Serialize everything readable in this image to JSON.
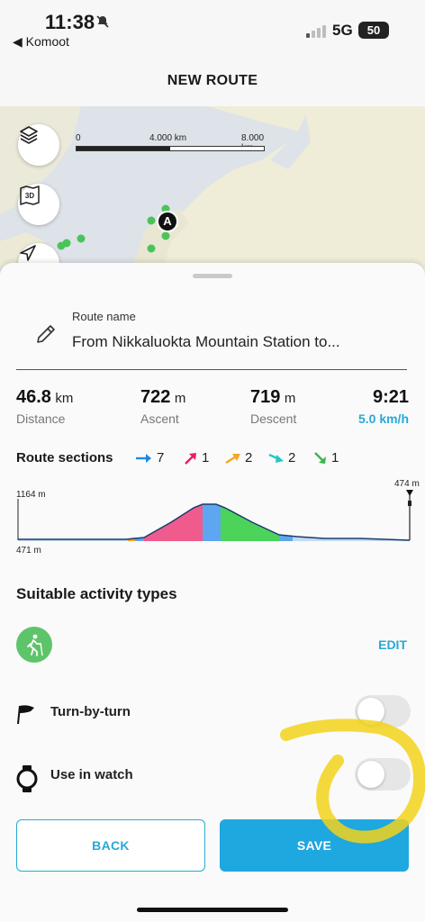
{
  "status_bar": {
    "time": "11:38",
    "back_app": "◀ Komoot",
    "network": "5G",
    "battery": "50"
  },
  "header": {
    "title": "NEW ROUTE"
  },
  "map": {
    "scale_labels": [
      "0",
      "4.000 km",
      "8.000 km"
    ],
    "marker_label": "A",
    "buttons": [
      "layers-icon",
      "3d-icon",
      "navigation-icon"
    ]
  },
  "route": {
    "name_label": "Route name",
    "name_value": "From Nikkaluokta Mountain Station to..."
  },
  "stats": {
    "distance": {
      "value": "46.8",
      "unit": "km",
      "caption": "Distance"
    },
    "ascent": {
      "value": "722",
      "unit": "m",
      "caption": "Ascent"
    },
    "descent": {
      "value": "719",
      "unit": "m",
      "caption": "Descent"
    },
    "duration": {
      "value": "9:21",
      "caption": "5.0 km/h"
    }
  },
  "route_sections": {
    "title": "Route sections",
    "items": [
      {
        "icon": "arrow-right-icon",
        "color": "#1e88e5",
        "count": "7"
      },
      {
        "icon": "arrow-up-right-icon",
        "color": "#e91e63",
        "count": "1"
      },
      {
        "icon": "arrow-slight-up-icon",
        "color": "#f5a623",
        "count": "2"
      },
      {
        "icon": "arrow-slight-down-icon",
        "color": "#26c6c6",
        "count": "2"
      },
      {
        "icon": "arrow-down-right-icon",
        "color": "#3bb54a",
        "count": "1"
      }
    ]
  },
  "profile": {
    "max_label": "1164 m",
    "min_label": "471 m",
    "end_label": "474 m"
  },
  "activity": {
    "title": "Suitable activity types",
    "edit_label": "EDIT",
    "icon": "hiking-icon"
  },
  "toggles": {
    "turn_by_turn": {
      "label": "Turn-by-turn",
      "on": false
    },
    "use_in_watch": {
      "label": "Use in watch",
      "on": false
    }
  },
  "buttons": {
    "back": "BACK",
    "save": "SAVE"
  },
  "colors": {
    "accent": "#1fa7e0",
    "activity_green": "#5ec46a"
  }
}
